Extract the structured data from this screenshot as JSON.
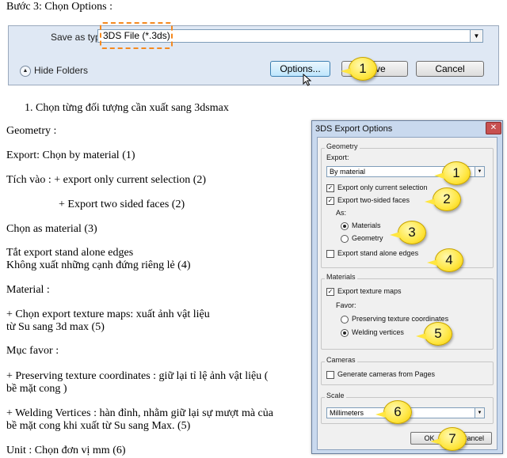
{
  "heading": "Bước 3: Chọn Options :",
  "save_dialog": {
    "save_as_label": "Save as type:",
    "file_type": "3DS File (*.3ds)",
    "hide_folders": "Hide Folders",
    "options_button": "Options...",
    "save_button": "Save",
    "cancel_button": "Cancel"
  },
  "list_item": "1. Chọn từng đối tượng cần xuất sang 3dsmax",
  "body_lines": [
    "Geometry :",
    "Export: Chọn by material  (1)",
    "Tích  vào : + export only current selection  (2)",
    "+ Export two sided faces  (2)",
    "Chọn as material   (3)",
    "Tắt export stand alone edges",
    "Không xuất những cạnh đứng riêng lẻ (4)",
    "Material  :",
    "+ Chọn export texture maps: xuất ảnh vật liệu",
    "từ Su sang 3d max (5)",
    "Mục favor :",
    "+  Preserving  texture  coordinates : giữ lại tỉ lệ ảnh vật liệu (",
    "bề  mặt cong )",
    "+ Welding Vertices : hàn đỉnh, nhằm giữ lại sự mượt mà của",
    "bề mặt cong khi xuất từ Su sang Max. (5)",
    "Unit : Chọn đơn vị mm (6)"
  ],
  "export_dialog": {
    "title": "3DS Export Options",
    "close": "✕",
    "geometry_group": "Geometry",
    "export_label": "Export:",
    "export_value": "By material",
    "export_only_selection": "Export only current selection",
    "export_two_sided": "Export two-sided faces",
    "as_label": "As:",
    "materials_radio": "Materials",
    "geometry_radio": "Geometry",
    "export_stand_alone": "Export stand alone edges",
    "materials_group": "Materials",
    "export_texture_maps": "Export texture maps",
    "favor_label": "Favor:",
    "preserving_texture": "Preserving texture coordinates",
    "welding_vertices": "Welding vertices",
    "cameras_group": "Cameras",
    "generate_cameras": "Generate cameras from Pages",
    "scale_group": "Scale",
    "scale_value": "Millimeters",
    "ok_button": "OK",
    "cancel_button": "Cancel"
  },
  "callouts": [
    "1",
    "1",
    "2",
    "3",
    "4",
    "5",
    "6",
    "7"
  ]
}
